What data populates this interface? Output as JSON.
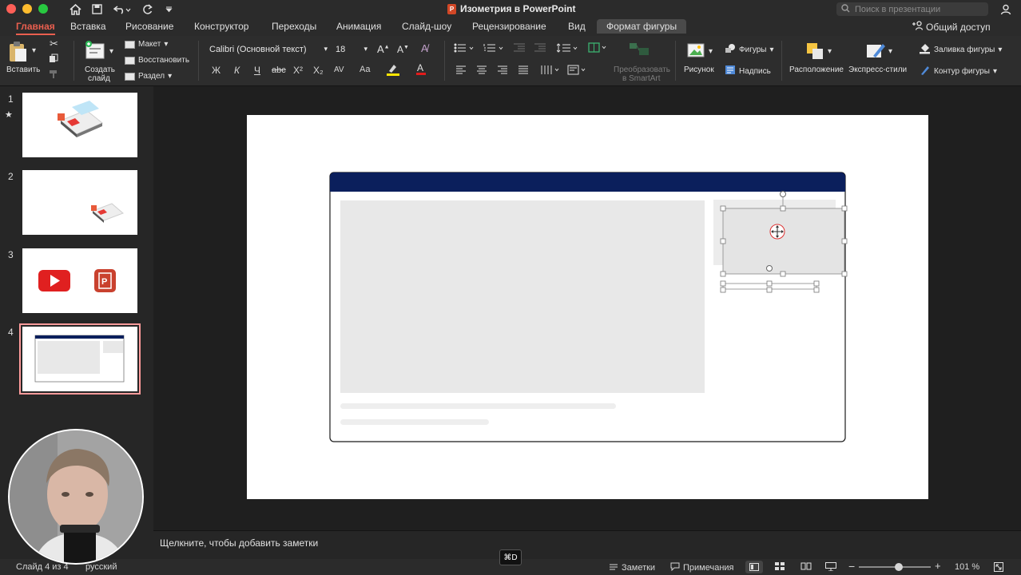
{
  "window": {
    "title": "Изометрия в PowerPoint",
    "search_placeholder": "Поиск в презентации"
  },
  "tabs": [
    {
      "label": "Главная",
      "active": true
    },
    {
      "label": "Вставка"
    },
    {
      "label": "Рисование"
    },
    {
      "label": "Конструктор"
    },
    {
      "label": "Переходы"
    },
    {
      "label": "Анимация"
    },
    {
      "label": "Слайд-шоу"
    },
    {
      "label": "Рецензирование"
    },
    {
      "label": "Вид"
    },
    {
      "label": "Формат фигуры",
      "contextual": true
    }
  ],
  "share_label": "Общий доступ",
  "ribbon": {
    "paste": "Вставить",
    "new_slide_line1": "Создать",
    "new_slide_line2": "слайд",
    "layout": "Макет",
    "reset": "Восстановить",
    "section": "Раздел",
    "font_name": "Calibri (Основной текст)",
    "font_size": "18",
    "bold": "Ж",
    "italic": "К",
    "underline": "Ч",
    "strike": "abc",
    "superscript": "X²",
    "subscript": "X₂",
    "spacing": "AV",
    "case": "Aa",
    "convert_line1": "Преобразовать",
    "convert_line2": "в SmartArt",
    "picture": "Рисунок",
    "shapes": "Фигуры",
    "textbox": "Надпись",
    "arrange": "Расположение",
    "quick_styles": "Экспресс-стили",
    "shape_fill": "Заливка фигуры",
    "shape_outline": "Контур фигуры"
  },
  "slides": [
    {
      "number": "1",
      "starred": true
    },
    {
      "number": "2"
    },
    {
      "number": "3"
    },
    {
      "number": "4",
      "selected": true
    }
  ],
  "notes_placeholder": "Щелкните, чтобы добавить заметки",
  "shortcut_badge": "⌘D",
  "status": {
    "slide_info": "Слайд 4 из 4",
    "language": "русский",
    "notes": "Заметки",
    "comments": "Примечания",
    "zoom": "101 %",
    "zoom_level": 0.55
  },
  "colors": {
    "accent": "#e95f4f",
    "header_navy": "#0b1f5c",
    "placeholder_gray": "#e8e8e8"
  }
}
